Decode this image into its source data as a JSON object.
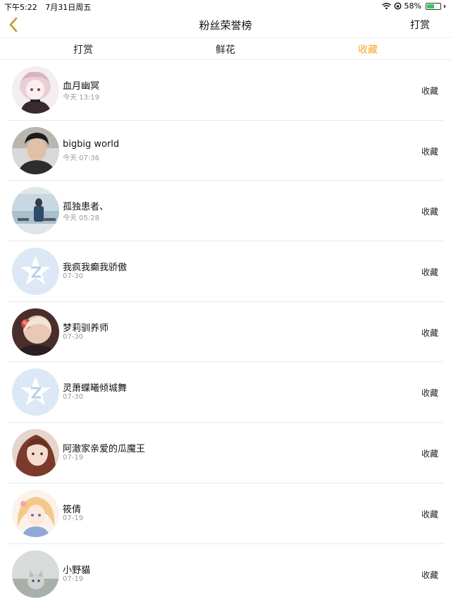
{
  "status_bar": {
    "time": "下午5:22",
    "date": "7月31日周五",
    "battery": "58%",
    "battery_level": 0.58
  },
  "nav": {
    "title": "粉丝荣誉榜",
    "right_label": "打赏",
    "back_icon": "chevron-left-icon",
    "accent_color": "#f5a623"
  },
  "tabs": [
    {
      "label": "打赏",
      "active": false
    },
    {
      "label": "鲜花",
      "active": false
    },
    {
      "label": "收藏",
      "active": true
    }
  ],
  "fans": [
    {
      "name": "血月幽冥",
      "time": "今天 13:19",
      "action": "收藏",
      "avatar": "anime-girl-pink"
    },
    {
      "name": "bigbig world",
      "time": "今天 07:36",
      "action": "收藏",
      "avatar": "man-photo"
    },
    {
      "name": "孤独患者、",
      "time": "今天 05:28",
      "action": "收藏",
      "avatar": "person-blue-scene"
    },
    {
      "name": "我疯我癫我骄傲",
      "time": "07-30",
      "action": "收藏",
      "avatar": "default-star"
    },
    {
      "name": "梦莉驯养师",
      "time": "07-30",
      "action": "收藏",
      "avatar": "anime-flower"
    },
    {
      "name": "灵萧蝶曦倾城舞",
      "time": "07-30",
      "action": "收藏",
      "avatar": "default-star"
    },
    {
      "name": "阿澈家亲爱的瓜魔王",
      "time": "07-19",
      "action": "收藏",
      "avatar": "girl-brown-hair"
    },
    {
      "name": "筱倩",
      "time": "07-19",
      "action": "收藏",
      "avatar": "anime-blonde"
    },
    {
      "name": "小野貓",
      "time": "07-19",
      "action": "收藏",
      "avatar": "cat-photo"
    }
  ]
}
